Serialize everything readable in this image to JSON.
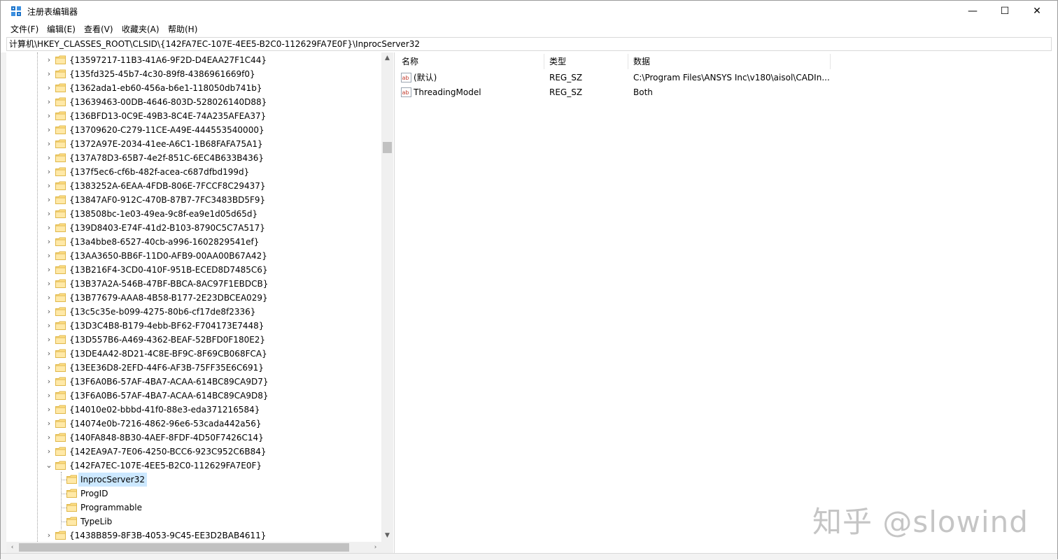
{
  "window": {
    "title": "注册表编辑器",
    "minimize_glyph": "—",
    "maximize_glyph": "☐",
    "close_glyph": "✕"
  },
  "menu": [
    {
      "label": "文件(F)"
    },
    {
      "label": "编辑(E)"
    },
    {
      "label": "查看(V)"
    },
    {
      "label": "收藏夹(A)"
    },
    {
      "label": "帮助(H)"
    }
  ],
  "address": "计算机\\HKEY_CLASSES_ROOT\\CLSID\\{142FA7EC-107E-4EE5-B2C0-112629FA7E0F}\\InprocServer32",
  "tree": {
    "items": [
      "{13597217-11B3-41A6-9F2D-D4EAA27F1C44}",
      "{135fd325-45b7-4c30-89f8-4386961669f0}",
      "{1362ada1-eb60-456a-b6e1-118050db741b}",
      "{13639463-00DB-4646-803D-528026140D88}",
      "{136BFD13-0C9E-49B3-8C4E-74A235AFEA37}",
      "{13709620-C279-11CE-A49E-444553540000}",
      "{1372A97E-2034-41ee-A6C1-1B68FAFA75A1}",
      "{137A78D3-65B7-4e2f-851C-6EC4B633B436}",
      "{137f5ec6-cf6b-482f-acea-c687dfbd199d}",
      "{1383252A-6EAA-4FDB-806E-7FCCF8C29437}",
      "{13847AF0-912C-470B-87B7-7FC3483BD5F9}",
      "{138508bc-1e03-49ea-9c8f-ea9e1d05d65d}",
      "{139D8403-E74F-41d2-B103-8790C5C7A517}",
      "{13a4bbe8-6527-40cb-a996-1602829541ef}",
      "{13AA3650-BB6F-11D0-AFB9-00AA00B67A42}",
      "{13B216F4-3CD0-410F-951B-ECED8D7485C6}",
      "{13B37A2A-546B-47BF-BBCA-8AC97F1EBDCB}",
      "{13B77679-AAA8-4B58-B177-2E23DBCEA029}",
      "{13c5c35e-b099-4275-80b6-cf17de8f2336}",
      "{13D3C4B8-B179-4ebb-BF62-F704173E7448}",
      "{13D557B6-A469-4362-BEAF-52BFD0F180E2}",
      "{13DE4A42-8D21-4C8E-BF9C-8F69CB068FCA}",
      "{13EE36D8-2EFD-44F6-AF3B-75FF35E6C691}",
      "{13F6A0B6-57AF-4BA7-ACAA-614BC89CA9D7}",
      "{13F6A0B6-57AF-4BA7-ACAA-614BC89CA9D8}",
      "{14010e02-bbbd-41f0-88e3-eda371216584}",
      "{14074e0b-7216-4862-96e6-53cada442a56}",
      "{140FA848-8B30-4AEF-8FDF-4D50F7426C14}",
      "{142EA9A7-7E06-4250-BCC6-923C952C6B84}"
    ],
    "expanded_key": "{142FA7EC-107E-4EE5-B2C0-112629FA7E0F}",
    "children": [
      "InprocServer32",
      "ProgID",
      "Programmable",
      "TypeLib"
    ],
    "selected_child": "InprocServer32",
    "after_item": "{1438B859-8F3B-4053-9C45-EE3D2BAB4611}",
    "collapsed_chevron": "›",
    "expanded_chevron": "⌄",
    "scroll_up_glyph": "▲",
    "scroll_down_glyph": "▼",
    "scroll_left_glyph": "‹",
    "scroll_right_glyph": "›",
    "folder_color": "#FFE08A"
  },
  "list": {
    "headers": {
      "name": "名称",
      "type": "类型",
      "data": "数据"
    },
    "rows": [
      {
        "icon": "reg-sz-icon",
        "name": "(默认)",
        "type": "REG_SZ",
        "data": "C:\\Program Files\\ANSYS Inc\\v180\\aisol\\CADIn..."
      },
      {
        "icon": "reg-sz-icon",
        "name": "ThreadingModel",
        "type": "REG_SZ",
        "data": "Both"
      }
    ]
  },
  "watermark": "知乎 @slowind",
  "colors": {
    "selection": "#cce8ff",
    "folder": "#FFE08A",
    "folder_edge": "#E0B84A"
  }
}
